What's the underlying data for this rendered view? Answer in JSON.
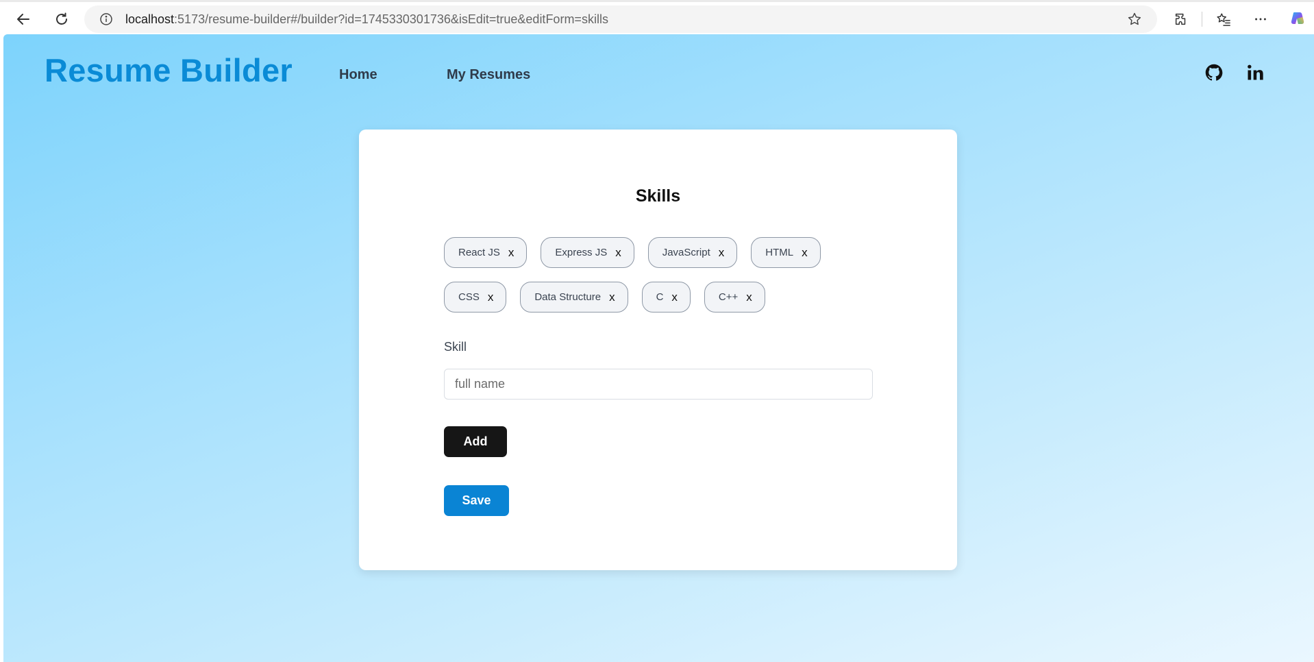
{
  "browser": {
    "url_host": "localhost",
    "url_rest": ":5173/resume-builder#/builder?id=1745330301736&isEdit=true&editForm=skills",
    "icons": [
      "back-arrow-icon",
      "reload-icon",
      "info-icon",
      "favorite-star-icon",
      "extensions-icon",
      "favorites-icon",
      "more-icon",
      "copilot-icon"
    ]
  },
  "header": {
    "logo": "Resume Builder",
    "nav": {
      "home": "Home",
      "my_resumes": "My Resumes"
    },
    "social_icons": [
      "github-icon",
      "linkedin-icon"
    ]
  },
  "skills_form": {
    "title": "Skills",
    "chips": [
      {
        "label": "React JS",
        "remove": "x"
      },
      {
        "label": "Express JS",
        "remove": "x"
      },
      {
        "label": "JavaScript",
        "remove": "x"
      },
      {
        "label": "HTML",
        "remove": "x"
      },
      {
        "label": "CSS",
        "remove": "x"
      },
      {
        "label": "Data Structure",
        "remove": "x"
      },
      {
        "label": "C",
        "remove": "x"
      },
      {
        "label": "C++",
        "remove": "x"
      }
    ],
    "field_label": "Skill",
    "input_value": "",
    "input_placeholder": "full name",
    "add_label": "Add",
    "save_label": "Save"
  },
  "colors": {
    "logo": "#0a8bd6",
    "add_button": "#161616",
    "save_button": "#0a84d4",
    "gradient_start": "#7dd3fc",
    "gradient_end": "#eaf7ff"
  }
}
